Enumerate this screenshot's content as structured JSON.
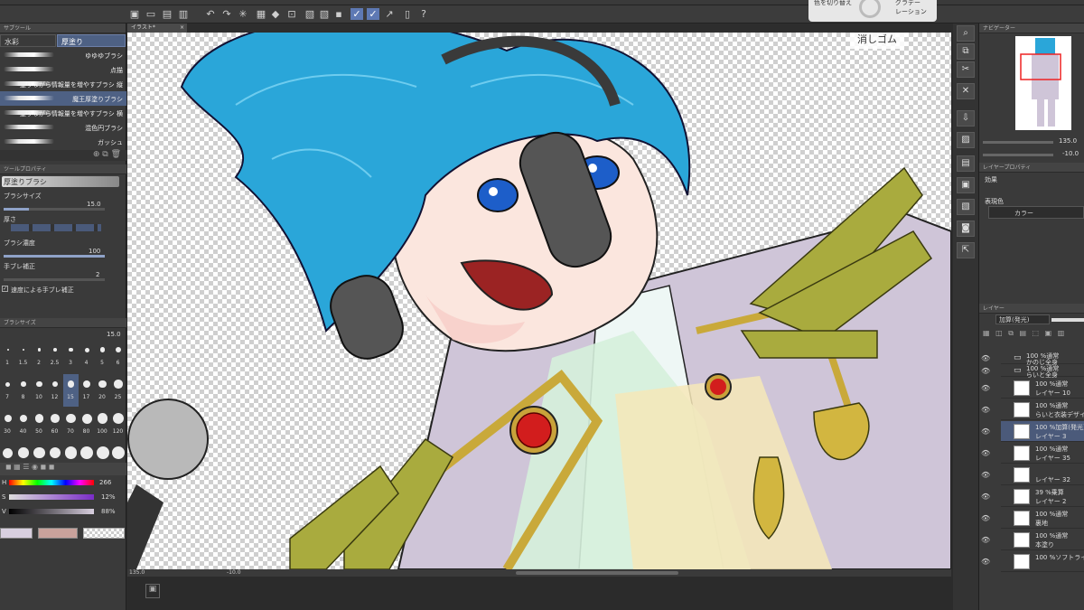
{
  "toolbar": {
    "tab": "イラスト*"
  },
  "popup": {
    "left": "色を切り替え",
    "right_1": "グラデー",
    "right_2": "レーション"
  },
  "subtool": {
    "header": "サブツール",
    "tab1": "水彩",
    "tab2": "厚塗り",
    "brushes": [
      "ゆゆゆブラシ",
      "点描",
      "塗りながら情報量を増やすブラシ 縦",
      "魔王厚塗りブラシ",
      "塗りながら情報量を増やすブラシ 横",
      "混色円ブラシ",
      "ガッシュ"
    ]
  },
  "tool_property": {
    "header": "ツールプロパティ",
    "tool": "厚塗りブラシ",
    "size_label": "ブラシサイズ",
    "size_value": "15.0",
    "thickness_label": "厚さ",
    "opacity_label": "ブラシ濃度",
    "opacity_value": "100",
    "stab_label": "手ブレ補正",
    "stab_value": "2",
    "speed_label": "速度による手ブレ補正"
  },
  "brush_size": {
    "header": "ブラシサイズ",
    "value": "15.0",
    "sizes": [
      "1",
      "1.5",
      "2",
      "2.5",
      "3",
      "4",
      "5",
      "6",
      "7",
      "8",
      "10",
      "12",
      "15",
      "17",
      "20",
      "25",
      "30",
      "40",
      "50",
      "60",
      "70",
      "80",
      "100",
      "120",
      "150",
      "170",
      "200",
      "250",
      "300",
      "400",
      "500",
      "600"
    ]
  },
  "color": {
    "h_label": "H",
    "h_value": "266",
    "s_label": "S",
    "s_value": "12%",
    "v_label": "V",
    "v_value": "88%",
    "main": "#d8cfdf",
    "sub": "#c9a29c"
  },
  "canvas": {
    "eraser_label": "消しゴム",
    "zoom": "135.0",
    "angle": "-10.0"
  },
  "navigator": {
    "header": "ナビゲーター",
    "zoom": "135.0",
    "angle": "-10.0"
  },
  "layer_property": {
    "header": "レイヤープロパティ",
    "effect_label": "効果",
    "express_label": "表現色",
    "express_value": "カラー"
  },
  "layers_panel": {
    "header": "レイヤー",
    "blend": "加算(発光)",
    "layers": [
      {
        "line1": "100 %通常",
        "line2": "かのじ全身"
      },
      {
        "line1": "100 %通常",
        "line2": "らいと全身"
      },
      {
        "line1": "100 %通常",
        "line2": "レイヤー 10"
      },
      {
        "line1": "100 %通常",
        "line2": "らいと衣装デザイン"
      },
      {
        "line1": "100 %加算(発光)",
        "line2": "レイヤー 3"
      },
      {
        "line1": "100 %通常",
        "line2": "レイヤー 35"
      },
      {
        "line1": "",
        "line2": "レイヤー 32"
      },
      {
        "line1": "39 %乗算",
        "line2": "レイヤー 2"
      },
      {
        "line1": "100 %通常",
        "line2": "裏地"
      },
      {
        "line1": "100 %通常",
        "line2": "本塗り"
      },
      {
        "line1": "100 %ソフトライト",
        "line2": ""
      }
    ]
  }
}
